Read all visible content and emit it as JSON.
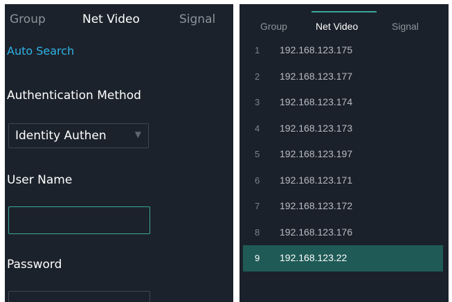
{
  "left": {
    "tabs": [
      {
        "label": "Group",
        "active": false
      },
      {
        "label": "Net Video",
        "active": true
      },
      {
        "label": "Signal",
        "active": false
      }
    ],
    "auto_search": "Auto Search",
    "auth_method_label": "Authentication Method",
    "auth_method_value": "Identity Authen",
    "user_name_label": "User Name",
    "user_name_value": "",
    "password_label": "Password"
  },
  "right": {
    "tabs": [
      {
        "label": "Group",
        "active": false
      },
      {
        "label": "Net Video",
        "active": true
      },
      {
        "label": "Signal",
        "active": false
      }
    ],
    "devices": [
      {
        "index": "1",
        "ip": "192.168.123.175"
      },
      {
        "index": "2",
        "ip": "192.168.123.177"
      },
      {
        "index": "3",
        "ip": "192.168.123.174"
      },
      {
        "index": "4",
        "ip": "192.168.123.173"
      },
      {
        "index": "5",
        "ip": "192.168.123.197"
      },
      {
        "index": "6",
        "ip": "192.168.123.171"
      },
      {
        "index": "7",
        "ip": "192.168.123.172"
      },
      {
        "index": "8",
        "ip": "192.168.123.176"
      },
      {
        "index": "9",
        "ip": "192.168.123.22"
      }
    ],
    "selected_index": 8
  },
  "colors": {
    "panel_bg": "#1c222b",
    "accent": "#3aa89c",
    "link": "#2fb4e8",
    "selected_row": "#1f5a56"
  }
}
